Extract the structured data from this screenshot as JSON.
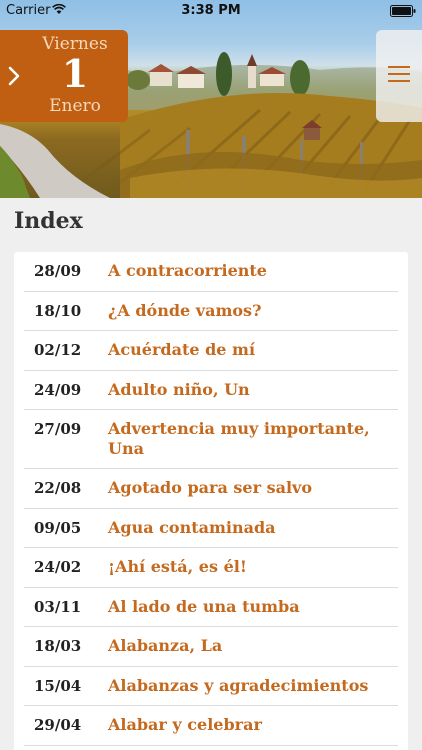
{
  "status_bar": {
    "carrier": "Carrier",
    "time": "3:38 PM",
    "wifi_icon": "wifi-icon",
    "battery_icon": "battery-icon"
  },
  "date_badge": {
    "weekday": "Viernes",
    "day": "1",
    "month": "Enero",
    "icon": "chevron-right-icon",
    "color": "#c05f12"
  },
  "menu": {
    "icon": "hamburger-icon"
  },
  "index": {
    "title": "Index",
    "accent_color": "#c4691d",
    "items": [
      {
        "date": "28/09",
        "title": "A contracorriente"
      },
      {
        "date": "18/10",
        "title": "¿A dónde vamos?"
      },
      {
        "date": "02/12",
        "title": "Acuérdate de mí"
      },
      {
        "date": "24/09",
        "title": "Adulto niño, Un"
      },
      {
        "date": "27/09",
        "title": "Advertencia muy importante, Una"
      },
      {
        "date": "22/08",
        "title": "Agotado para ser salvo"
      },
      {
        "date": "09/05",
        "title": "Agua contaminada"
      },
      {
        "date": "24/02",
        "title": "¡Ahí está, es él!"
      },
      {
        "date": "03/11",
        "title": "Al lado de una tumba"
      },
      {
        "date": "18/03",
        "title": "Alabanza, La"
      },
      {
        "date": "15/04",
        "title": "Alabanzas y agradecimientos"
      },
      {
        "date": "29/04",
        "title": "Alabar y celebrar"
      }
    ]
  }
}
